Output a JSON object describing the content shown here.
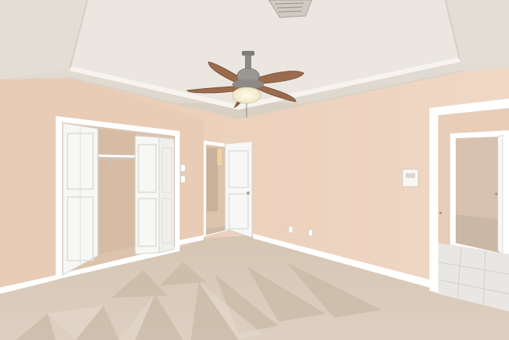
{
  "scene": {
    "description_free": true,
    "colors": {
      "ceiling": "#e6e1d9",
      "ceiling_tray": "#ece8e1",
      "wall": "#ecd2bd",
      "wall_shadow": "#dfc2ab",
      "trim": "#ffffff",
      "door": "#f7f7f5",
      "carpet": "#d9cbbb",
      "carpet_dark": "#c8b8a6",
      "closet_interior": "#d9c1ab",
      "fan_blade": "#9b6b4e",
      "fan_metal": "#8c8a85",
      "tile": "#e9e7e3",
      "far_room_wall": "#d8c0ae"
    },
    "icons": {
      "ceiling_fan": "ceiling-fan-icon",
      "air_vent": "air-vent-icon",
      "thermostat": "thermostat-icon",
      "light_switch": "light-switch-icon",
      "outlet": "outlet-icon"
    }
  }
}
